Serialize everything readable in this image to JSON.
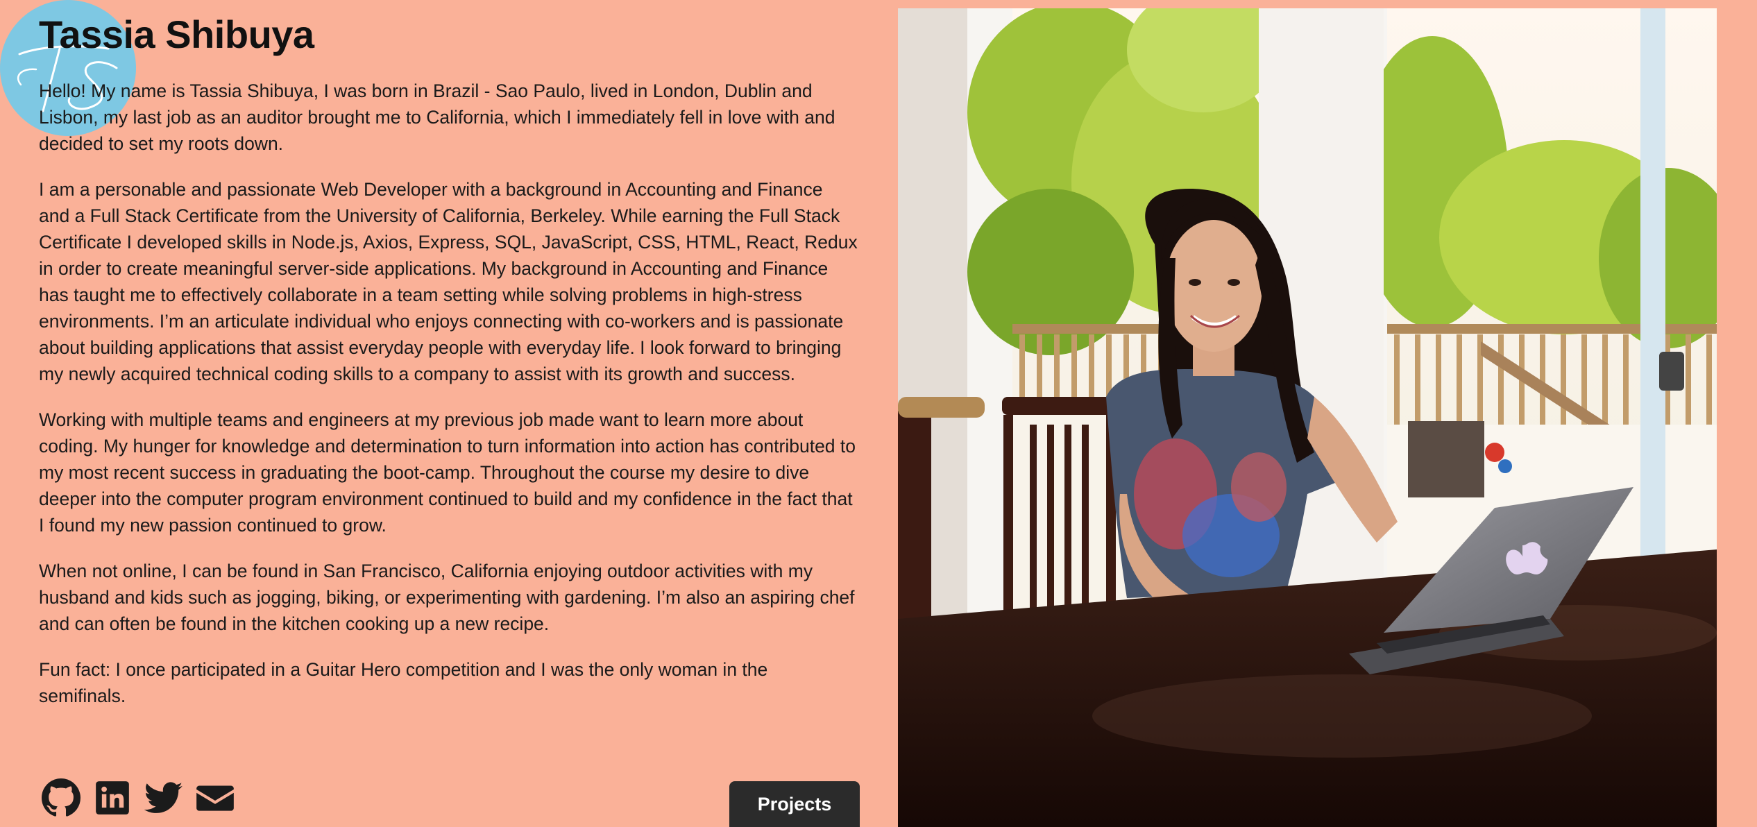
{
  "logo": {
    "initials": "TS"
  },
  "profile": {
    "name": "Tassia Shibuya",
    "paragraphs": [
      "Hello! My name is Tassia Shibuya, I was born in Brazil - Sao Paulo, lived in London, Dublin and Lisbon, my last job as an auditor brought me to California, which I immediately fell in love with and decided to set my roots down.",
      "I am a personable and passionate Web Developer with a background in Accounting and Finance and a Full Stack Certificate from the University of California, Berkeley. While earning the Full Stack Certificate I developed skills in Node.js, Axios, Express, SQL, JavaScript, CSS, HTML, React, Redux in order to create meaningful server-side applications. My background in Accounting and Finance has taught me to effectively collaborate in a team setting while solving problems in high-stress environments. I’m an articulate individual who enjoys connecting with co-workers and is passionate about building applications that assist everyday people with everyday life. I look forward to bringing my newly acquired technical coding skills to a company to assist with its growth and success.",
      "Working with multiple teams and engineers at my previous job made want to learn more about coding. My hunger for knowledge and determination to turn information into action has contributed to my most recent success in graduating the boot-camp. Throughout the course my desire to dive deeper into the computer program environment continued to build and my confidence in the fact that I found my new passion continued to grow.",
      "When not online, I can be found in San Francisco, California enjoying outdoor activities with my husband and kids such as jogging, biking, or experimenting with gardening. I’m also an aspiring chef and can often be found in the kitchen cooking up a new recipe.",
      "Fun fact: I once participated in a Guitar Hero competition and I was the only woman in the semifinals."
    ]
  },
  "socials": [
    {
      "icon": "github-icon"
    },
    {
      "icon": "linkedin-icon"
    },
    {
      "icon": "twitter-icon"
    },
    {
      "icon": "envelope-icon"
    }
  ],
  "buttons": {
    "projects_label": "Projects"
  },
  "colors": {
    "page_background": "#fab198",
    "logo_background": "#7ec8e3",
    "button_background": "#2b2b2b",
    "text": "#1a1a1a"
  }
}
